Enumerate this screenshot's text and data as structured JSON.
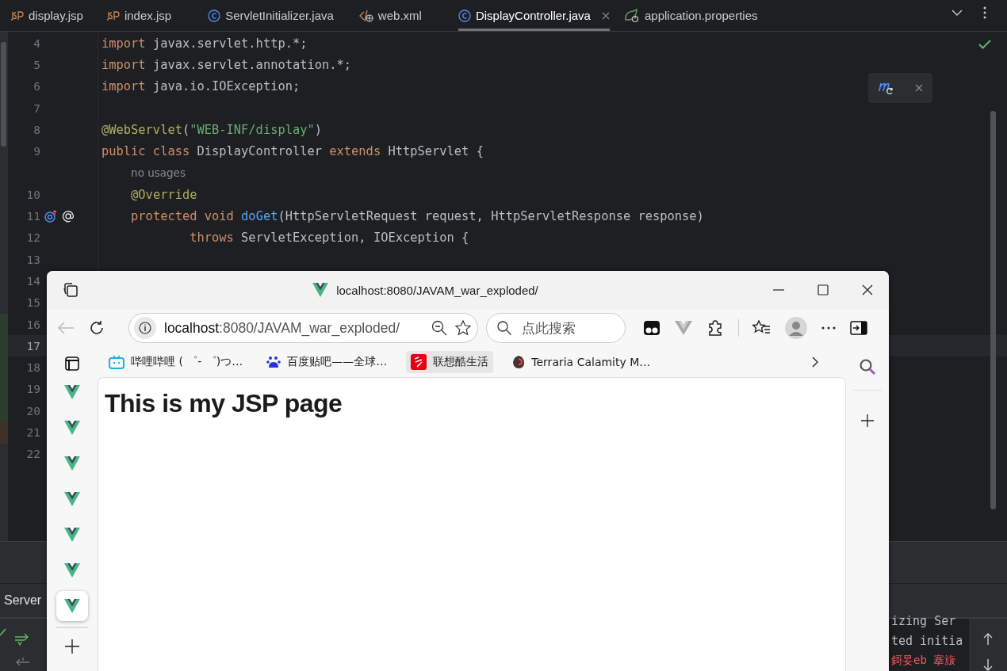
{
  "editor_tabs": [
    {
      "label": "display.jsp",
      "kind": "jsp",
      "selected": false,
      "closable": false
    },
    {
      "label": "index.jsp",
      "kind": "jsp",
      "selected": false,
      "closable": false
    },
    {
      "label": "ServletInitializer.java",
      "kind": "class",
      "selected": false,
      "closable": false
    },
    {
      "label": "web.xml",
      "kind": "xml",
      "selected": false,
      "closable": false
    },
    {
      "label": "DisplayController.java",
      "kind": "class",
      "selected": true,
      "closable": true
    },
    {
      "label": "application.properties",
      "kind": "spring",
      "selected": false,
      "closable": false
    }
  ],
  "code_lines": [
    {
      "number": "4",
      "current": false,
      "kind": "plain",
      "tokens": [
        {
          "kind": "keyword",
          "text": "import"
        },
        {
          "kind": "plain",
          "text": " javax.servlet.http.*;"
        }
      ]
    },
    {
      "number": "5",
      "current": false,
      "kind": "plain",
      "tokens": [
        {
          "kind": "keyword",
          "text": "import"
        },
        {
          "kind": "plain",
          "text": " javax.servlet.annotation.*;"
        }
      ]
    },
    {
      "number": "6",
      "current": false,
      "kind": "plain",
      "tokens": [
        {
          "kind": "keyword",
          "text": "import"
        },
        {
          "kind": "plain",
          "text": " java.io.IOException;"
        }
      ]
    },
    {
      "number": "7",
      "current": false,
      "kind": "plain"
    },
    {
      "number": "8",
      "current": false,
      "kind": "plain",
      "tokens": [
        {
          "kind": "annotation",
          "text": "@WebServlet"
        },
        {
          "kind": "plain",
          "text": "("
        },
        {
          "kind": "string",
          "text": "\"WEB-INF/display\""
        },
        {
          "kind": "plain",
          "text": ")"
        }
      ]
    },
    {
      "number": "9",
      "current": false,
      "kind": "plain",
      "tokens": [
        {
          "kind": "keyword",
          "text": "public class"
        },
        {
          "kind": "plain",
          "text": " DisplayController "
        },
        {
          "kind": "keyword",
          "text": "extends"
        },
        {
          "kind": "plain",
          "text": " HttpServlet {"
        }
      ]
    },
    {
      "current": false,
      "kind": "plain",
      "tokens": [
        {
          "kind": "inlay",
          "text": "    no usages"
        }
      ]
    },
    {
      "number": "10",
      "current": false,
      "kind": "plain",
      "tokens": [
        {
          "kind": "annotation",
          "text": "    @Override"
        }
      ]
    },
    {
      "number": "11",
      "current": false,
      "kind": "plain",
      "gutter_icons": true,
      "tokens": [
        {
          "kind": "keyword",
          "text": "    protected void"
        },
        {
          "kind": "method",
          "text": " doGet"
        },
        {
          "kind": "plain",
          "text": "(HttpServletRequest request, HttpServletResponse response)"
        }
      ]
    },
    {
      "number": "12",
      "current": false,
      "kind": "plain",
      "tokens": [
        {
          "kind": "keyword",
          "text": "            throws"
        },
        {
          "kind": "plain",
          "text": " ServletException, IOException {"
        }
      ]
    },
    {
      "number": "13",
      "current": false,
      "kind": "plain"
    },
    {
      "number": "14",
      "current": false,
      "kind": "plain"
    },
    {
      "number": "15",
      "current": false,
      "kind": "plain"
    },
    {
      "number": "16",
      "current": false,
      "kind": "added"
    },
    {
      "number": "17",
      "current": true,
      "kind": "added"
    },
    {
      "number": "18",
      "current": false,
      "kind": "added"
    },
    {
      "number": "19",
      "current": false,
      "kind": "added"
    },
    {
      "number": "20",
      "current": false,
      "kind": "added"
    },
    {
      "number": "21",
      "current": false,
      "kind": "modified"
    },
    {
      "number": "22",
      "current": false,
      "kind": "plain"
    }
  ],
  "bottom_panel": {
    "tab": "Server",
    "console_lines": [
      {
        "text": "izing Ser",
        "kind": "info"
      },
      {
        "text": "ted initia",
        "kind": "info"
      },
      {
        "text": "鎶妟eb 搴旇",
        "kind": "error"
      }
    ]
  },
  "browser": {
    "title": "localhost:8080/JAVAM_war_exploded/",
    "address": {
      "host": "localhost",
      "path": ":8080/JAVAM_war_exploded/"
    },
    "search": {
      "placeholder": "点此搜索"
    },
    "back_disabled": true,
    "bookmarks": [
      {
        "label": "哔哩哔哩 ( ゜- ゜)つ…",
        "kind": "tv",
        "selected": false
      },
      {
        "label": "百度贴吧——全球…",
        "kind": "paw",
        "selected": false
      },
      {
        "label": "联想酷生活",
        "kind": "red",
        "selected": true
      },
      {
        "label": "Terraria Calamity M…",
        "kind": "game",
        "selected": false
      }
    ],
    "vertical_tabs": [
      {
        "selected": false
      },
      {
        "selected": false
      },
      {
        "selected": false
      },
      {
        "selected": false
      },
      {
        "selected": false
      },
      {
        "selected": false
      },
      {
        "selected": true
      }
    ],
    "page_heading": "This is my JSP page"
  }
}
